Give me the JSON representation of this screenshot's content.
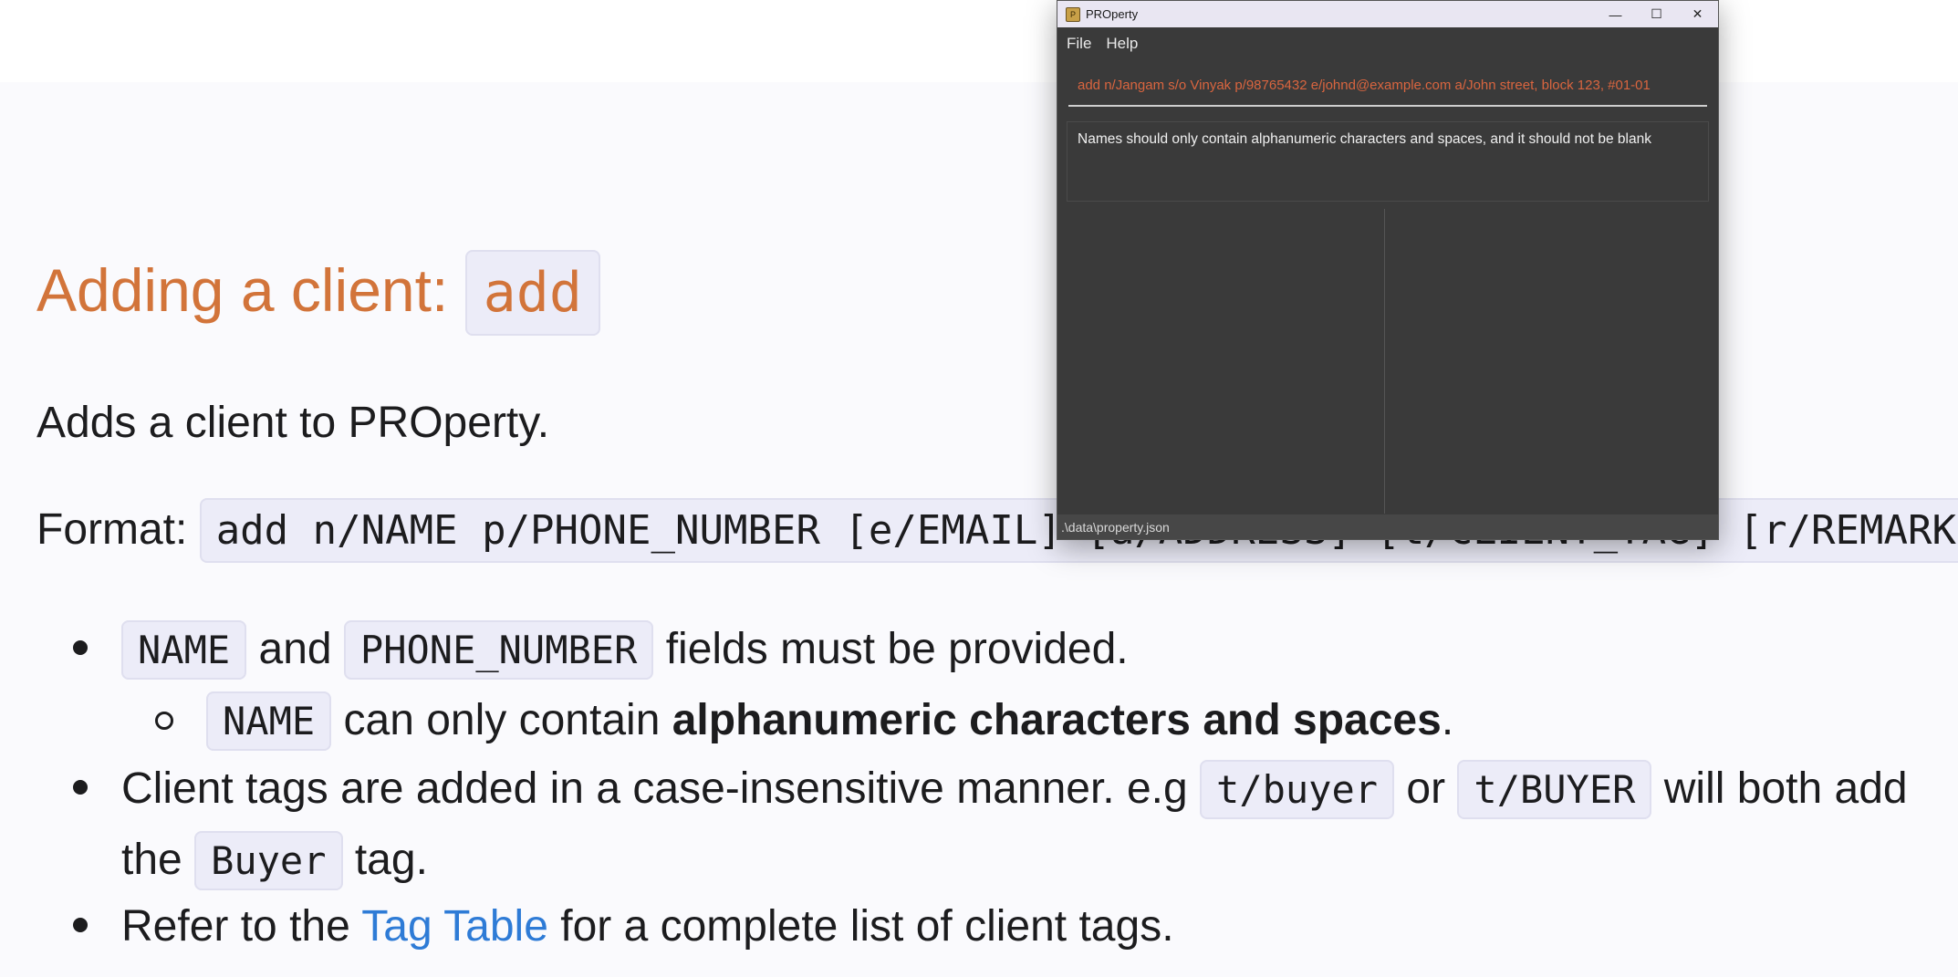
{
  "doc": {
    "heading_text": "Adding a client: ",
    "heading_code": "add",
    "intro": "Adds a client to PROperty.",
    "format_label": "Format: ",
    "format_code": "add n/NAME p/PHONE_NUMBER [e/EMAIL] [a/ADDRESS] [t/CLIENT_TAG] [r/REMARKS]…",
    "bullet1": {
      "code1": "NAME",
      "text1": " and ",
      "code2": "PHONE_NUMBER",
      "text2": " fields must be provided."
    },
    "sub1": {
      "code": "NAME",
      "text1": " can only contain ",
      "bold": "alphanumeric characters and spaces",
      "text2": "."
    },
    "bullet2": {
      "text1": "Client tags are added in a case-insensitive manner. e.g ",
      "code1": "t/buyer",
      "text2": " or ",
      "code2": "t/BUYER",
      "text3": " will both add"
    },
    "bullet2_cont": {
      "text1": "the ",
      "code": "Buyer",
      "text2": " tag."
    },
    "bullet3": {
      "text1": "Refer to the ",
      "link": "Tag Table",
      "text2": " for a complete list of client tags."
    }
  },
  "app": {
    "title": "PROperty",
    "icon_glyph": "P",
    "controls": {
      "minimize": "—",
      "maximize": "☐",
      "close": "✕"
    },
    "menu": [
      "File",
      "Help"
    ],
    "command_value": "add n/Jangam s/o Vinyak p/98765432 e/johnd@example.com a/John street, block 123, #01-01",
    "result_text": "Names should only contain alphanumeric characters and spaces, and it should not be blank",
    "status_path": ".\\data\\property.json"
  }
}
